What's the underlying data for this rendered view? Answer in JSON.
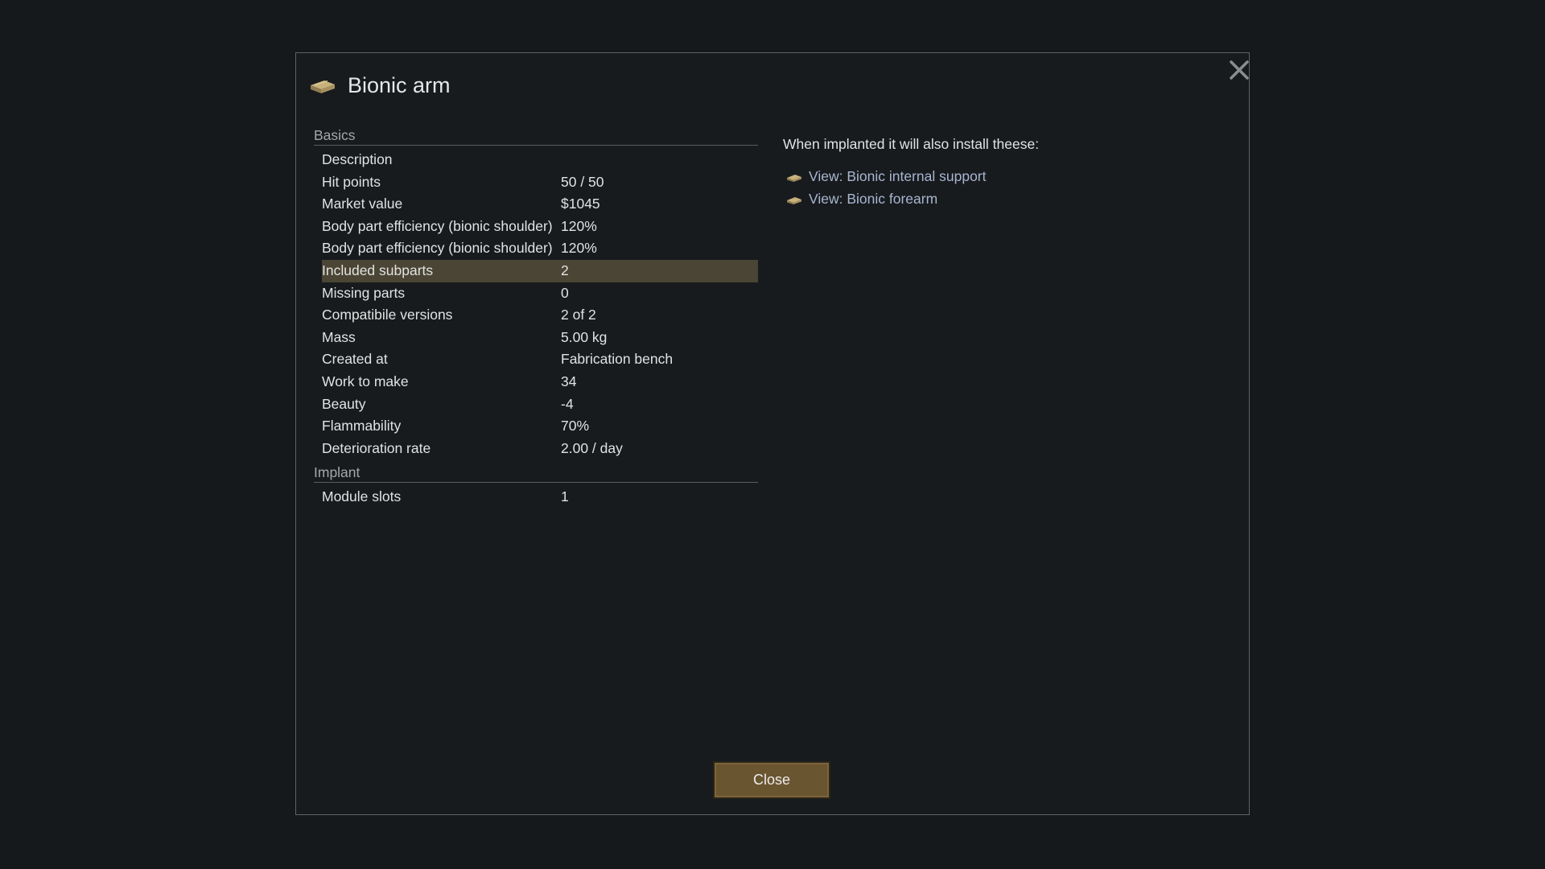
{
  "dialog": {
    "title": "Bionic arm",
    "title_icon": "bionic-arm-icon",
    "close_icon": "close-x-icon"
  },
  "sections": [
    {
      "header": "Basics",
      "rows": [
        {
          "label": "Description",
          "value": ""
        },
        {
          "label": "Hit points",
          "value": "50 / 50"
        },
        {
          "label": "Market value",
          "value": "$1045"
        },
        {
          "label": "Body part efficiency (bionic shoulder)",
          "value": "120%"
        },
        {
          "label": "Body part efficiency (bionic shoulder)",
          "value": "120%"
        },
        {
          "label": "Included subparts",
          "value": "2",
          "selected": true
        },
        {
          "label": "Missing parts",
          "value": "0"
        },
        {
          "label": "Compatibile versions",
          "value": "2 of 2"
        },
        {
          "label": "Mass",
          "value": "5.00 kg"
        },
        {
          "label": "Created at",
          "value": "Fabrication bench"
        },
        {
          "label": "Work to make",
          "value": "34"
        },
        {
          "label": "Beauty",
          "value": "-4"
        },
        {
          "label": "Flammability",
          "value": "70%"
        },
        {
          "label": "Deterioration rate",
          "value": "2.00 / day"
        }
      ]
    },
    {
      "header": "Implant",
      "rows": [
        {
          "label": "Module slots",
          "value": "1"
        }
      ]
    }
  ],
  "details": {
    "heading": "When implanted it will also install theese:",
    "links": [
      {
        "label": "View: Bionic internal support",
        "icon": "bionic-part-icon"
      },
      {
        "label": "View: Bionic forearm",
        "icon": "bionic-part-icon"
      }
    ]
  },
  "footer": {
    "close_label": "Close"
  },
  "colors": {
    "background": "#15191c",
    "panel_border": "#5f6366",
    "selected_row": "#4a4534",
    "link": "#a9b6d0",
    "button": "#6a5531"
  }
}
